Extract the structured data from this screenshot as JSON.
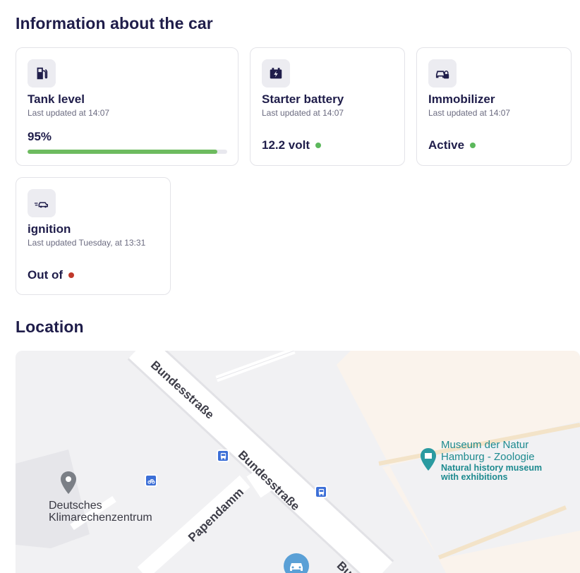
{
  "sections": {
    "info_title": "Information about the car",
    "location_title": "Location"
  },
  "cards": {
    "tank": {
      "title": "Tank level",
      "updated": "Last updated at 14:07",
      "value": "95%",
      "progress": 0.95,
      "icon": "fuel-pump-icon"
    },
    "battery": {
      "title": "Starter battery",
      "updated": "Last updated at 14:07",
      "value": "12.2 volt",
      "status_color": "#5cb85c",
      "icon": "battery-icon"
    },
    "immobilizer": {
      "title": "Immobilizer",
      "updated": "Last updated at 14:07",
      "value": "Active",
      "status_color": "#5cb85c",
      "icon": "car-lock-icon"
    },
    "ignition": {
      "title": "ignition",
      "updated": "Last updated Tuesday, at 13:31",
      "value": "Out of",
      "status_color": "#c0392b",
      "icon": "moving-car-icon"
    }
  },
  "map": {
    "streets": [
      "Bundesstraße",
      "Bundesstraße",
      "Papendamm",
      "Bund"
    ],
    "poi_left": [
      "Deutsches",
      "Klimarechenzentrum"
    ],
    "poi_museum": [
      "Museum der Natur",
      "Hamburg - Zoologie"
    ],
    "poi_museum_desc": [
      "Natural history museum",
      "with exhibitions"
    ],
    "icons": [
      "location-pin-icon",
      "bus-stop-icon",
      "bike-station-icon",
      "museum-pin-icon",
      "car-marker-icon"
    ]
  },
  "colors": {
    "accent_dark": "#1f1d4a",
    "progress_fill": "#6dbb5f",
    "bus_blue": "#3c6fd7",
    "poi_teal": "#1d8a8f"
  }
}
